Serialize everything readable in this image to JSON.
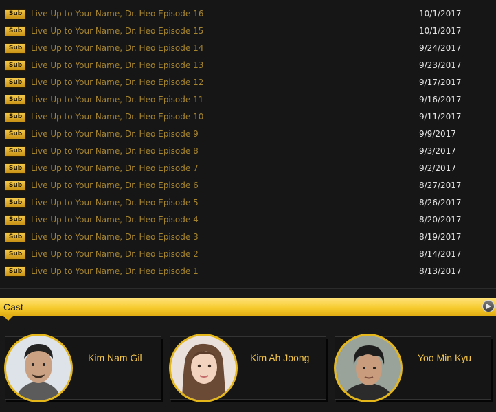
{
  "episodes": [
    {
      "badge": "Sub",
      "title": "Live Up to Your Name, Dr. Heo Episode 16",
      "date": "10/1/2017"
    },
    {
      "badge": "Sub",
      "title": "Live Up to Your Name, Dr. Heo Episode 15",
      "date": "10/1/2017"
    },
    {
      "badge": "Sub",
      "title": "Live Up to Your Name, Dr. Heo Episode 14",
      "date": "9/24/2017"
    },
    {
      "badge": "Sub",
      "title": "Live Up to Your Name, Dr. Heo Episode 13",
      "date": "9/23/2017"
    },
    {
      "badge": "Sub",
      "title": "Live Up to Your Name, Dr. Heo Episode 12",
      "date": "9/17/2017"
    },
    {
      "badge": "Sub",
      "title": "Live Up to Your Name, Dr. Heo Episode 11",
      "date": "9/16/2017"
    },
    {
      "badge": "Sub",
      "title": "Live Up to Your Name, Dr. Heo Episode 10",
      "date": "9/11/2017"
    },
    {
      "badge": "Sub",
      "title": "Live Up to Your Name, Dr. Heo Episode 9",
      "date": "9/9/2017"
    },
    {
      "badge": "Sub",
      "title": "Live Up to Your Name, Dr. Heo Episode 8",
      "date": "9/3/2017"
    },
    {
      "badge": "Sub",
      "title": "Live Up to Your Name, Dr. Heo Episode 7",
      "date": "9/2/2017"
    },
    {
      "badge": "Sub",
      "title": "Live Up to Your Name, Dr. Heo Episode 6",
      "date": "8/27/2017"
    },
    {
      "badge": "Sub",
      "title": "Live Up to Your Name, Dr. Heo Episode 5",
      "date": "8/26/2017"
    },
    {
      "badge": "Sub",
      "title": "Live Up to Your Name, Dr. Heo Episode 4",
      "date": "8/20/2017"
    },
    {
      "badge": "Sub",
      "title": "Live Up to Your Name, Dr. Heo Episode 3",
      "date": "8/19/2017"
    },
    {
      "badge": "Sub",
      "title": "Live Up to Your Name, Dr. Heo Episode 2",
      "date": "8/14/2017"
    },
    {
      "badge": "Sub",
      "title": "Live Up to Your Name, Dr. Heo Episode 1",
      "date": "8/13/2017"
    }
  ],
  "cast": {
    "title": "Cast",
    "more_icon": "play-icon",
    "members": [
      {
        "name": "Kim Nam Gil"
      },
      {
        "name": "Kim Ah Joong"
      },
      {
        "name": "Yoo Min Kyu"
      }
    ]
  },
  "colors": {
    "accent": "#f6cb2e",
    "link": "#a58430",
    "badge": "#e0ad12",
    "date": "#e3e3e3",
    "background": "#161616"
  }
}
